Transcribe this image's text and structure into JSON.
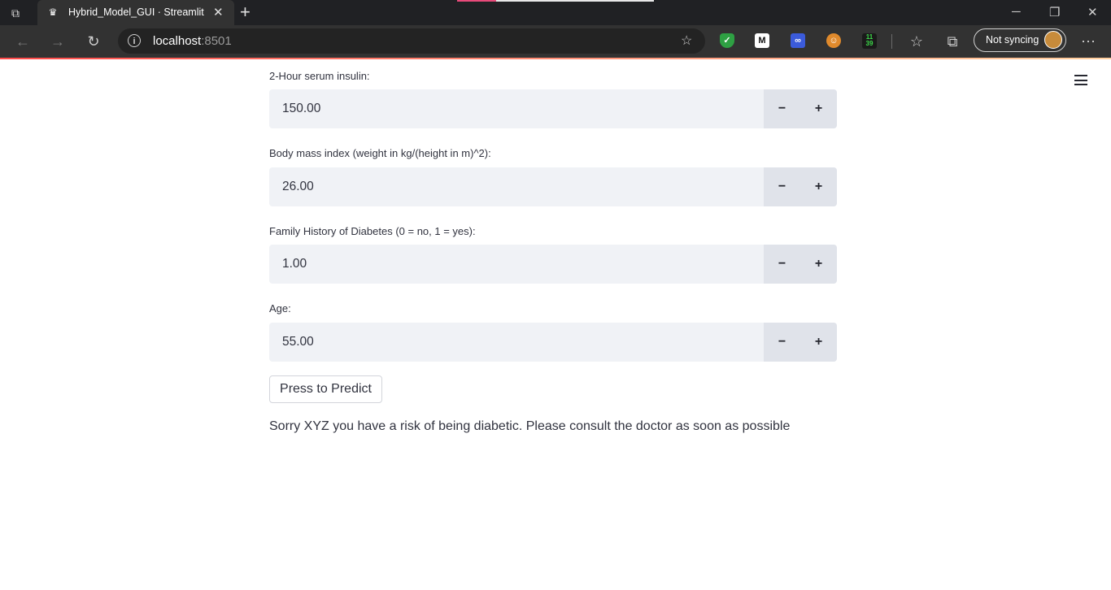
{
  "browser": {
    "tab_title": "Hybrid_Model_GUI · Streamlit",
    "url_host": "localhost",
    "url_port": ":8501",
    "sync_label": "Not syncing",
    "extension_badge": "11\n39",
    "extension_m": "M"
  },
  "form": {
    "fields": [
      {
        "label": "2-Hour serum insulin:",
        "value": "150.00"
      },
      {
        "label": "Body mass index (weight in kg/(height in m)^2):",
        "value": "26.00"
      },
      {
        "label": "Family History of Diabetes (0 = no, 1 = yes):",
        "value": "1.00"
      },
      {
        "label": "Age:",
        "value": "55.00"
      }
    ],
    "minus_symbol": "−",
    "plus_symbol": "+"
  },
  "predict_button_label": "Press to Predict",
  "result_text": "Sorry XYZ you have a risk of being diabetic. Please consult the doctor as soon as possible",
  "colors": {
    "input_bg": "#f0f2f6",
    "stepper_bg": "#e0e3ea",
    "text": "#31333f",
    "accent": "#ff4b4b"
  }
}
